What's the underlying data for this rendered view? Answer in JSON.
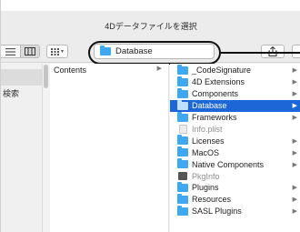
{
  "window": {
    "title": "4Dデータファイルを選択"
  },
  "toolbar": {
    "path_popup_label": "Database",
    "path_popup_icon": "folder-icon",
    "view_buttons": [
      "list-view-icon",
      "column-view-icon"
    ],
    "arrange_icon": "grid-icon",
    "share_icon": "share-icon"
  },
  "sidebar": {
    "partial_text": "検索"
  },
  "column1": {
    "item": "Contents"
  },
  "column2": {
    "items": [
      {
        "label": "_CodeSignature",
        "icon": "folder-icon",
        "has_arrow": true,
        "selected": false,
        "dim": false
      },
      {
        "label": "4D Extensions",
        "icon": "folder-icon",
        "has_arrow": true,
        "selected": false,
        "dim": false
      },
      {
        "label": "Components",
        "icon": "folder-icon",
        "has_arrow": true,
        "selected": false,
        "dim": false
      },
      {
        "label": "Database",
        "icon": "folder-icon",
        "has_arrow": true,
        "selected": true,
        "dim": false
      },
      {
        "label": "Frameworks",
        "icon": "folder-icon",
        "has_arrow": true,
        "selected": false,
        "dim": false
      },
      {
        "label": "Info.plist",
        "icon": "file-icon",
        "has_arrow": false,
        "selected": false,
        "dim": true
      },
      {
        "label": "Licenses",
        "icon": "folder-icon",
        "has_arrow": true,
        "selected": false,
        "dim": false
      },
      {
        "label": "MacOS",
        "icon": "folder-icon",
        "has_arrow": true,
        "selected": false,
        "dim": false
      },
      {
        "label": "Native Components",
        "icon": "folder-icon",
        "has_arrow": true,
        "selected": false,
        "dim": false
      },
      {
        "label": "PkgInfo",
        "icon": "pkg-icon",
        "has_arrow": false,
        "selected": false,
        "dim": true
      },
      {
        "label": "Plugins",
        "icon": "folder-icon",
        "has_arrow": true,
        "selected": false,
        "dim": false
      },
      {
        "label": "Resources",
        "icon": "folder-icon",
        "has_arrow": true,
        "selected": false,
        "dim": false
      },
      {
        "label": "SASL Plugins",
        "icon": "folder-icon",
        "has_arrow": true,
        "selected": false,
        "dim": false
      }
    ]
  },
  "colors": {
    "selection": "#1d66d7",
    "folder": "#3ea8f2",
    "callout": "#111111"
  }
}
